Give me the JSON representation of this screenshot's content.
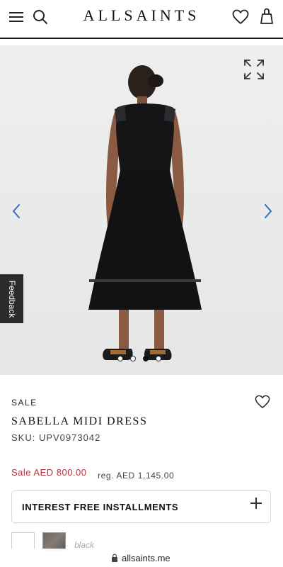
{
  "header": {
    "logo": "ALLSAINTS",
    "icons": [
      "menu-icon",
      "search-icon",
      "heart-icon",
      "bag-icon"
    ]
  },
  "gallery": {
    "icons": [
      "expand-icon",
      "chevron-left-icon",
      "chevron-right-icon"
    ],
    "dot_count": 4,
    "active_dot": 3
  },
  "feedback": {
    "label": "Feedback"
  },
  "product": {
    "badge": "SALE",
    "name": "SABELLA MIDI DRESS",
    "sku": "SKU: UPV0973042",
    "sale_price": "Sale AED 800.00",
    "regular_price": "reg. AED 1,145.00",
    "installments_label": "INTEREST FREE INSTALLMENTS",
    "swatch_label": "black"
  },
  "browser": {
    "url": "allsaints.me"
  },
  "colors": {
    "sale_red": "#b3323b",
    "text_dark": "#111111",
    "chevron_blue": "#2f6fc4",
    "feedback_bg": "#2b2b2b"
  }
}
